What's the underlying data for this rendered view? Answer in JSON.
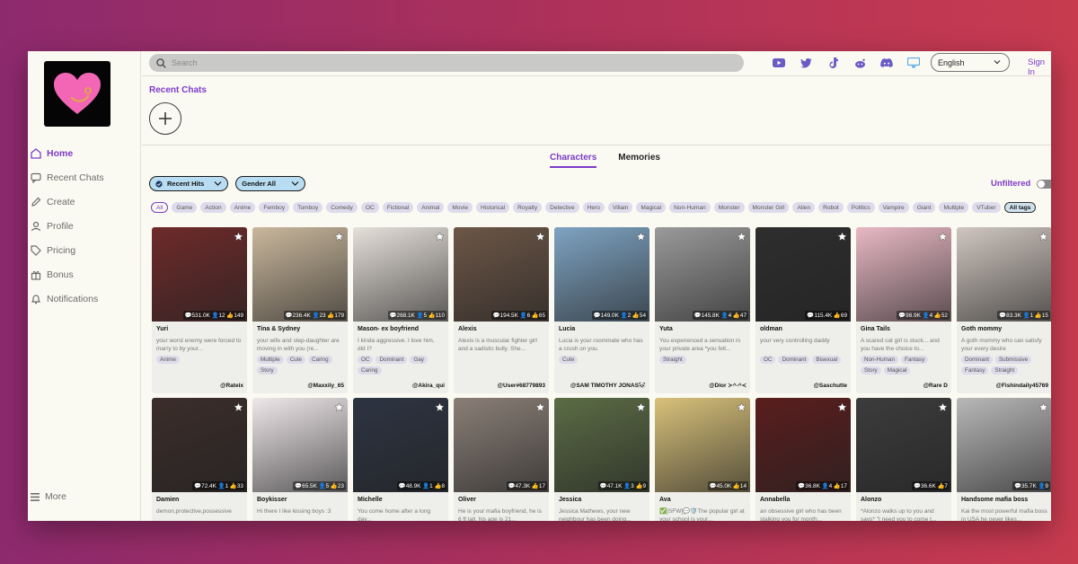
{
  "sidebar": {
    "items": [
      {
        "label": "Home",
        "icon": "home-icon",
        "active": true
      },
      {
        "label": "Recent Chats",
        "icon": "chat-icon",
        "active": false
      },
      {
        "label": "Create",
        "icon": "edit-icon",
        "active": false
      },
      {
        "label": "Profile",
        "icon": "user-icon",
        "active": false
      },
      {
        "label": "Pricing",
        "icon": "tag-icon",
        "active": false
      },
      {
        "label": "Bonus",
        "icon": "gift-icon",
        "active": false
      },
      {
        "label": "Notifications",
        "icon": "bell-icon",
        "active": false
      }
    ],
    "more_label": "More"
  },
  "header": {
    "search_placeholder": "Search",
    "language": "English",
    "signin_label": "Sign In",
    "socials": [
      "youtube-icon",
      "twitter-icon",
      "tiktok-icon",
      "reddit-icon",
      "discord-icon",
      "monitor-icon"
    ]
  },
  "recent": {
    "title": "Recent Chats"
  },
  "tabs": [
    {
      "label": "Characters",
      "active": true
    },
    {
      "label": "Memories",
      "active": false
    }
  ],
  "filters": [
    {
      "label": "Recent Hits"
    },
    {
      "label": "Gender All"
    }
  ],
  "unfiltered_label": "Unfiltered",
  "tags": [
    "All",
    "Game",
    "Action",
    "Anime",
    "Femboy",
    "Tomboy",
    "Comedy",
    "OC",
    "Fictional",
    "Animal",
    "Movie",
    "Historical",
    "Royalty",
    "Detective",
    "Hero",
    "Villain",
    "Magical",
    "Non-Human",
    "Monster",
    "Monster Girl",
    "Alien",
    "Robot",
    "Politics",
    "Vampire",
    "Giant",
    "Multiple",
    "VTuber"
  ],
  "all_tags_label": "All tags",
  "colors": {
    "accent": "#7d3ac8",
    "background": "#fbfaf2",
    "logo_heart": "#f266b5"
  },
  "cards_row1": [
    {
      "name": "Yuri",
      "stats": "💬531.0K 👤12 👍149",
      "desc": "your worst enemy were forced to marry to by your...",
      "tags": [
        "Anime"
      ],
      "author": "@Rateix",
      "tone": "#6e2a2a"
    },
    {
      "name": "Tina & Sydney",
      "stats": "💬236.4K 👤23 👍179",
      "desc": "your wife and step-daughter are moving in with you (re...",
      "tags": [
        "Multiple",
        "Cute",
        "Caring",
        "Story"
      ],
      "author": "@Maxxily_65",
      "tone": "#c9b79c"
    },
    {
      "name": "Mason- ex boyfriend",
      "stats": "💬268.1K 👤5 👍110",
      "desc": "I kinda aggressive. I love him, did I?",
      "tags": [
        "OC",
        "Dominant",
        "Gay",
        "Caring"
      ],
      "author": "@Akira_qui",
      "tone": "#e6e0da"
    },
    {
      "name": "Alexis",
      "stats": "💬194.5K 👤6 👍65",
      "desc": "Alexis is a muscular fighter girl and a sadistic bully. She...",
      "tags": [],
      "author": "@User#68779893",
      "tone": "#6c5647"
    },
    {
      "name": "Lucia",
      "stats": "💬149.0K 👤2 👍54",
      "desc": "Lucia is your roommate who has a crush on you.",
      "tags": [
        "Cute"
      ],
      "author": "@SAM TIMOTHY JONAS🐼",
      "tone": "#7ea3c2"
    },
    {
      "name": "Yuta",
      "stats": "💬145.8K 👤4 👍47",
      "desc": "You experienced a sensation in your private area *you felt...",
      "tags": [
        "Straight"
      ],
      "author": "@Dior ≻^-^≺",
      "tone": "#9a9a9a"
    },
    {
      "name": "oldman",
      "stats": "💬115.4K 👍69",
      "desc": "your very controlling daddy",
      "tags": [
        "OC",
        "Dominant",
        "Bisexual"
      ],
      "author": "@Saschutte",
      "tone": "#2e2e2e"
    },
    {
      "name": "Gina Tails",
      "stats": "💬98.9K 👤4 👍52",
      "desc": "A scared cat girl is stuck... and you have the choice to...",
      "tags": [
        "Non-Human",
        "Fantasy",
        "Story",
        "Magical"
      ],
      "author": "@Rare D",
      "tone": "#e8b8c4"
    },
    {
      "name": "Goth mommy",
      "stats": "💬83.3K 👤1 👍15",
      "desc": "A goth mommy who can satisfy your every desire",
      "tags": [
        "Dominant",
        "Submissive",
        "Fantasy",
        "Straight"
      ],
      "author": "@Fishindaily45769",
      "tone": "#cfc6bf"
    }
  ],
  "cards_row2": [
    {
      "name": "Damien",
      "stats": "💬72.4K 👤1 👍33",
      "desc": "demon,protective,possessive",
      "tone": "#3b2d2a"
    },
    {
      "name": "Boykisser",
      "stats": "💬65.5K 👤5 👍23",
      "desc": "Hi there I like kissing boys :3",
      "tone": "#efe8ea"
    },
    {
      "name": "Michelle",
      "stats": "💬48.9K 👤1 👍8",
      "desc": "You come home after a long day...",
      "tone": "#2d3442"
    },
    {
      "name": "Oliver",
      "stats": "💬47.3K 👍17",
      "desc": "He is your mafia boyfriend, he is 6 ft tall, his age is 21...",
      "tone": "#8a7f77"
    },
    {
      "name": "Jessica",
      "stats": "💬47.1K 👤3 👍9",
      "desc": "Jessica Mathews, your new neighbour has been doing...",
      "tone": "#5b6c45"
    },
    {
      "name": "Ava",
      "stats": "💬45.0K 👍14",
      "desc": "✅[SFW]💬🛡️The popular girl at your school is your...",
      "tone": "#d8c17a"
    },
    {
      "name": "Annabella",
      "stats": "💬36.8K 👤4 👍17",
      "desc": "an obsessive girl who has been stalking you for month...",
      "tone": "#5a1d1d"
    },
    {
      "name": "Alonzo",
      "stats": "💬36.6K 👍7",
      "desc": "*Alonzo walks up to you and says* \"I need you to come t...",
      "tone": "#3c3c3c"
    },
    {
      "name": "Handsome mafia boss",
      "stats": "💬35.7K 👤9",
      "desc": "Kai the most powerful mafia boss in USA he never likes...",
      "tone": "#b8b8b8"
    }
  ]
}
